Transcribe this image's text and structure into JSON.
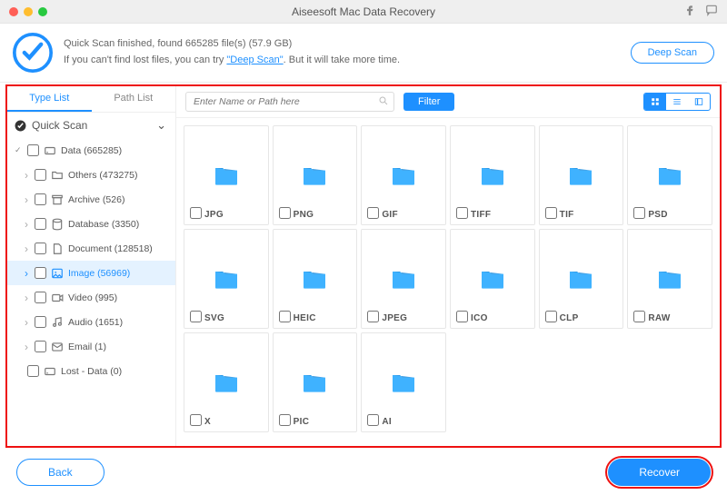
{
  "titlebar": {
    "app_title": "Aiseesoft Mac Data Recovery"
  },
  "status": {
    "line1_prefix": "Quick Scan finished, found ",
    "file_count": "665285",
    "line1_mid": " file(s) (",
    "total_size": "57.9 GB",
    "line1_suffix": ")",
    "line2_prefix": "If you can't find lost files, you can try ",
    "deep_scan_link": "\"Deep Scan\"",
    "line2_suffix": ". But it will take more time.",
    "deep_scan_btn": "Deep Scan"
  },
  "sidebar": {
    "tabs": {
      "type": "Type List",
      "path": "Path List"
    },
    "quick_scan_label": "Quick Scan",
    "tree": [
      {
        "label": "Data (665285)",
        "icon": "drive",
        "level": 0,
        "checked": true
      },
      {
        "label": "Others (473275)",
        "icon": "folder",
        "level": 1
      },
      {
        "label": "Archive (526)",
        "icon": "archive",
        "level": 1
      },
      {
        "label": "Database (3350)",
        "icon": "database",
        "level": 1
      },
      {
        "label": "Document (128518)",
        "icon": "document",
        "level": 1
      },
      {
        "label": "Image (56969)",
        "icon": "image",
        "level": 1,
        "selected": true
      },
      {
        "label": "Video (995)",
        "icon": "video",
        "level": 1
      },
      {
        "label": "Audio (1651)",
        "icon": "audio",
        "level": 1
      },
      {
        "label": "Email (1)",
        "icon": "email",
        "level": 1
      },
      {
        "label": "Lost - Data (0)",
        "icon": "drive",
        "level": 0
      }
    ]
  },
  "toolbar": {
    "search_placeholder": "Enter Name or Path here",
    "filter_label": "Filter"
  },
  "grid": {
    "items": [
      {
        "label": "JPG"
      },
      {
        "label": "PNG"
      },
      {
        "label": "GIF"
      },
      {
        "label": "TIFF"
      },
      {
        "label": "TIF"
      },
      {
        "label": "PSD"
      },
      {
        "label": "SVG"
      },
      {
        "label": "HEIC"
      },
      {
        "label": "JPEG"
      },
      {
        "label": "ICO"
      },
      {
        "label": "CLP"
      },
      {
        "label": "RAW"
      },
      {
        "label": "X"
      },
      {
        "label": "PIC"
      },
      {
        "label": "AI"
      }
    ]
  },
  "footer": {
    "back_label": "Back",
    "recover_label": "Recover"
  }
}
